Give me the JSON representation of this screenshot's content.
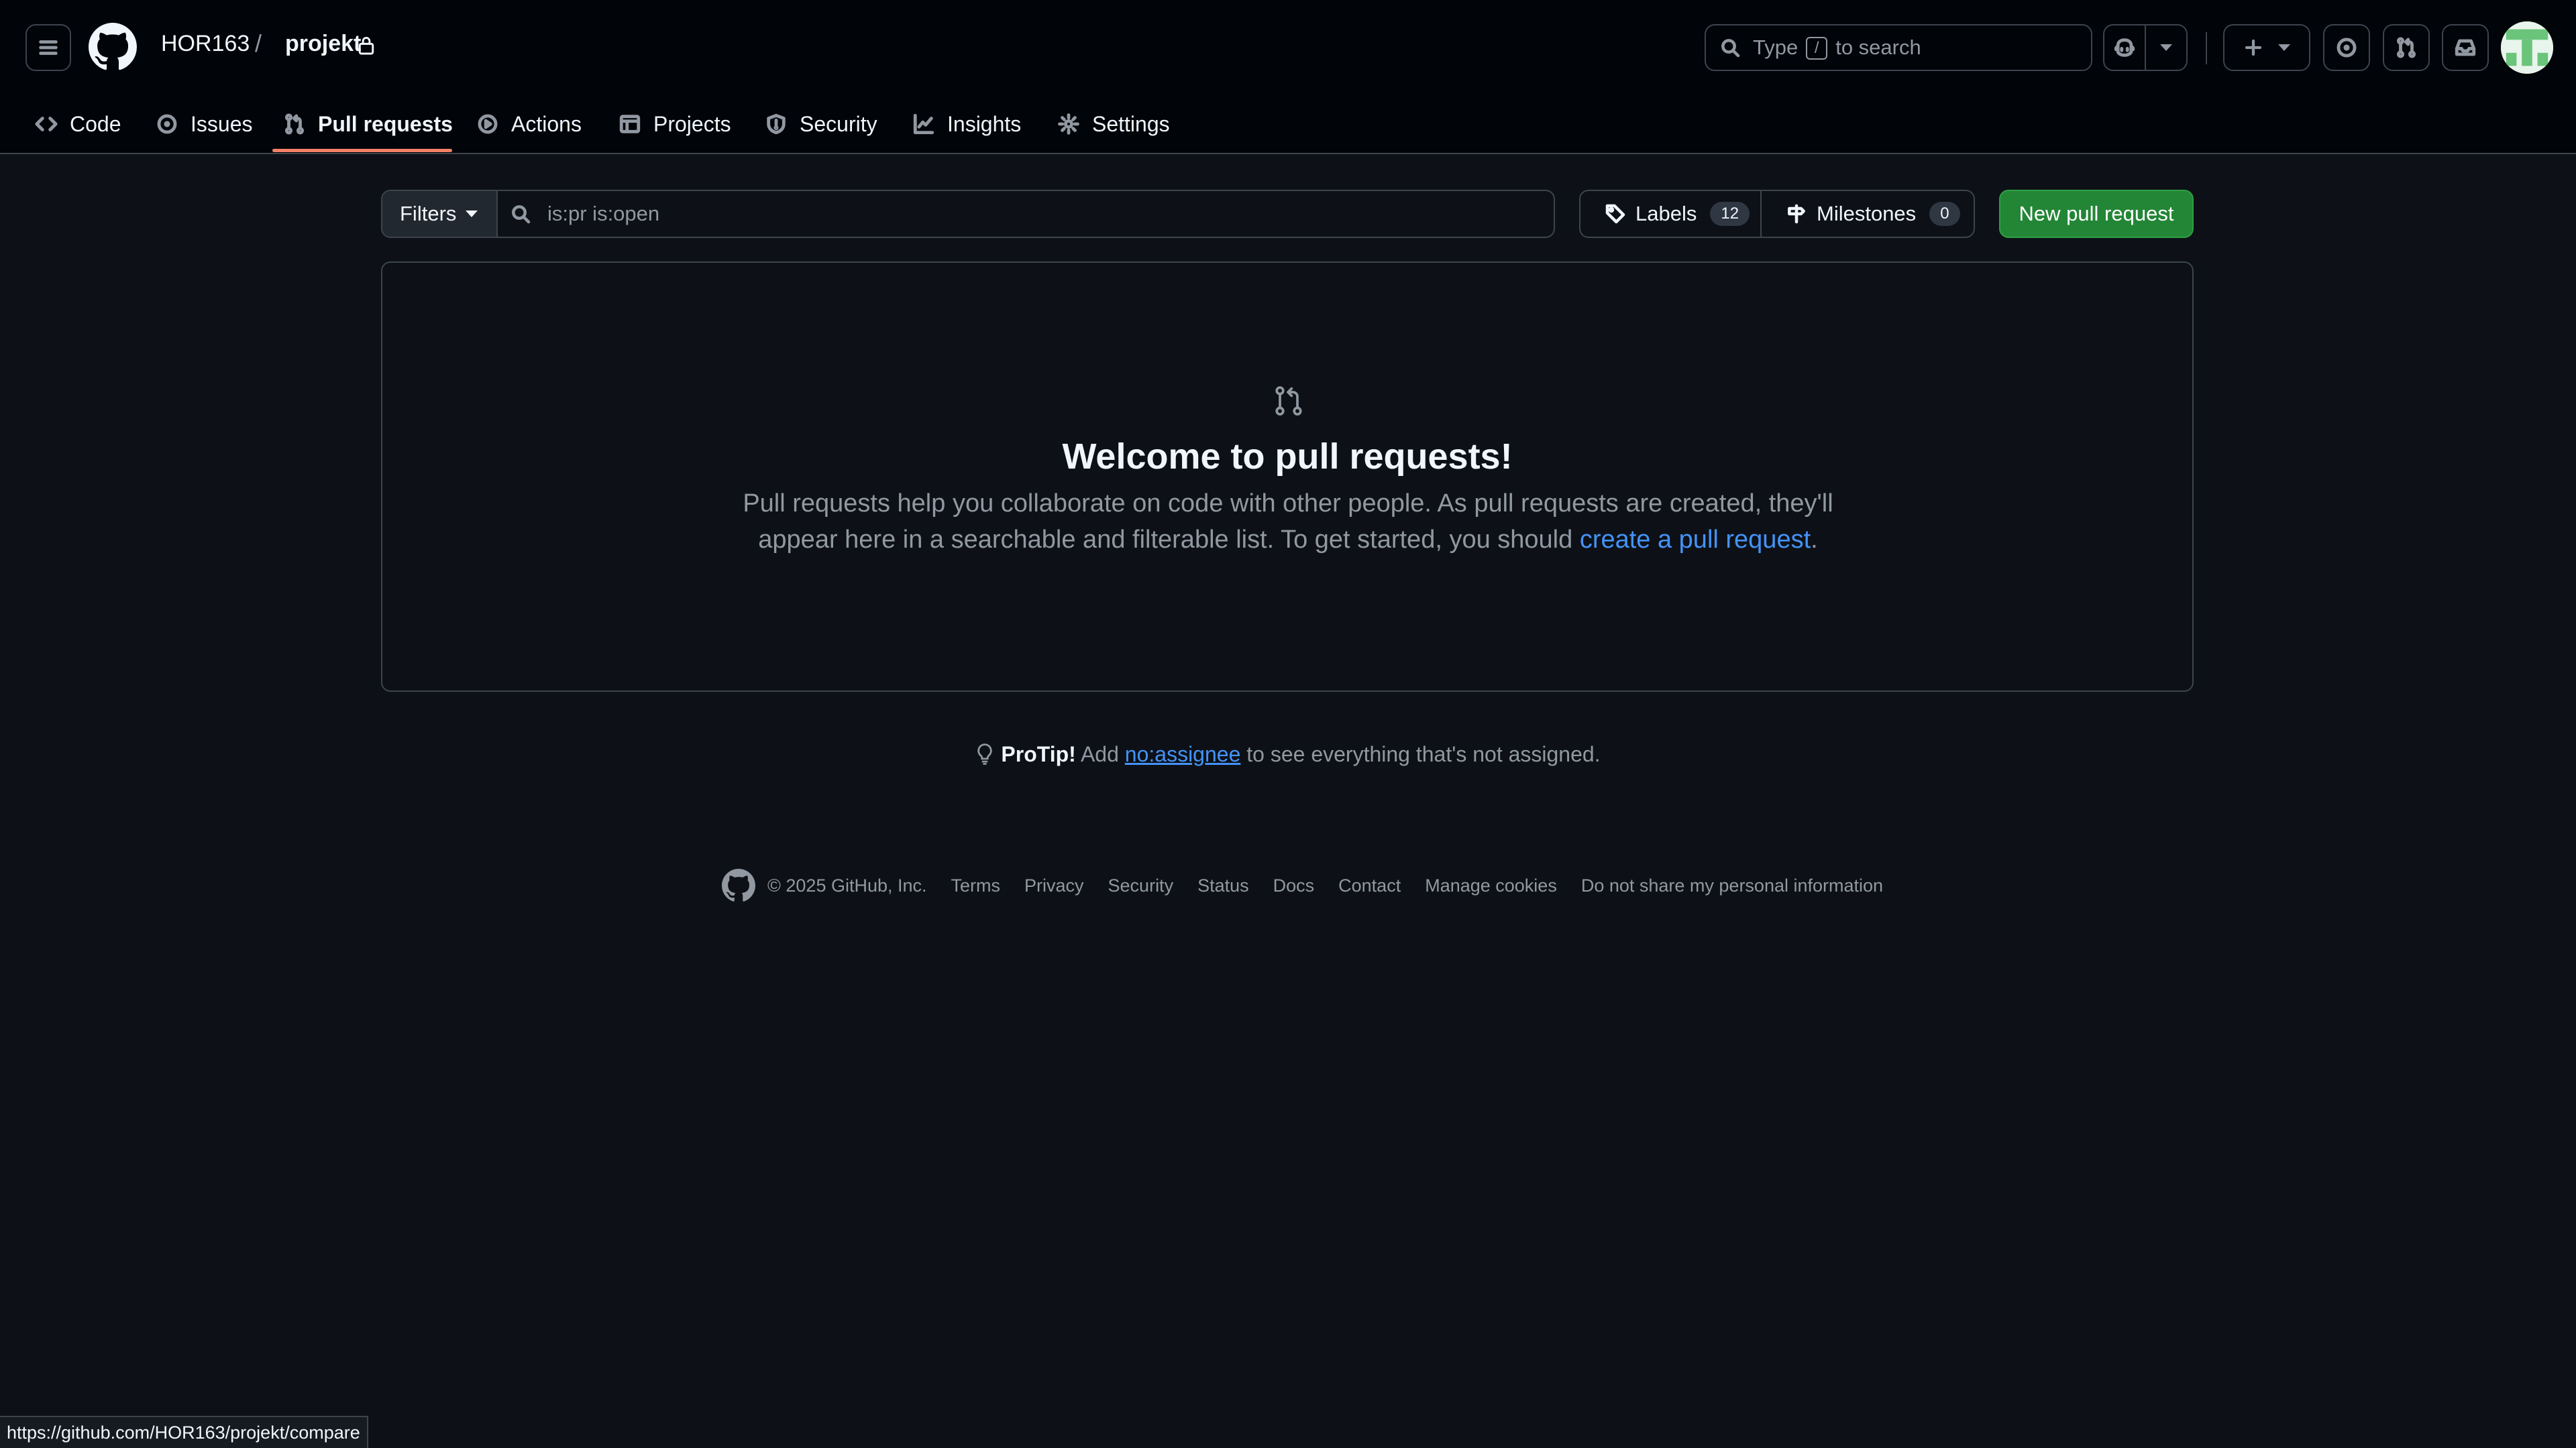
{
  "header": {
    "owner": "HOR163",
    "separator": "/",
    "repo": "projekt",
    "search": {
      "prefix": "Type",
      "key": "/",
      "suffix": "to search"
    }
  },
  "repo_nav": {
    "tabs": [
      {
        "label": "Code",
        "icon": "code-icon"
      },
      {
        "label": "Issues",
        "icon": "issue-opened-icon"
      },
      {
        "label": "Pull requests",
        "icon": "git-pull-request-icon",
        "active": true
      },
      {
        "label": "Actions",
        "icon": "play-icon"
      },
      {
        "label": "Projects",
        "icon": "table-icon"
      },
      {
        "label": "Security",
        "icon": "shield-icon"
      },
      {
        "label": "Insights",
        "icon": "graph-icon"
      },
      {
        "label": "Settings",
        "icon": "gear-icon"
      }
    ]
  },
  "toolbar": {
    "filters_label": "Filters",
    "search_placeholder": "is:pr is:open",
    "labels_label": "Labels",
    "labels_count": "12",
    "milestones_label": "Milestones",
    "milestones_count": "0",
    "new_pr_label": "New pull request"
  },
  "blankslate": {
    "title": "Welcome to pull requests!",
    "desc_before": "Pull requests help you collaborate on code with other people. As pull requests are created, they'll appear here in a searchable and filterable list. To get started, you should ",
    "link": "create a pull request",
    "desc_after": "."
  },
  "protip": {
    "label": "ProTip!",
    "pre": "Add",
    "link": "no:assignee",
    "post": "to see everything that's not assigned."
  },
  "footer": {
    "copyright": "© 2025 GitHub, Inc.",
    "links": [
      "Terms",
      "Privacy",
      "Security",
      "Status",
      "Docs",
      "Contact",
      "Manage cookies",
      "Do not share my personal information"
    ]
  },
  "status_url": "https://github.com/HOR163/projekt/compare",
  "colors": {
    "accent_underline": "#f78166",
    "primary_button": "#238636",
    "link": "#4493f8",
    "background": "#0d1117"
  }
}
